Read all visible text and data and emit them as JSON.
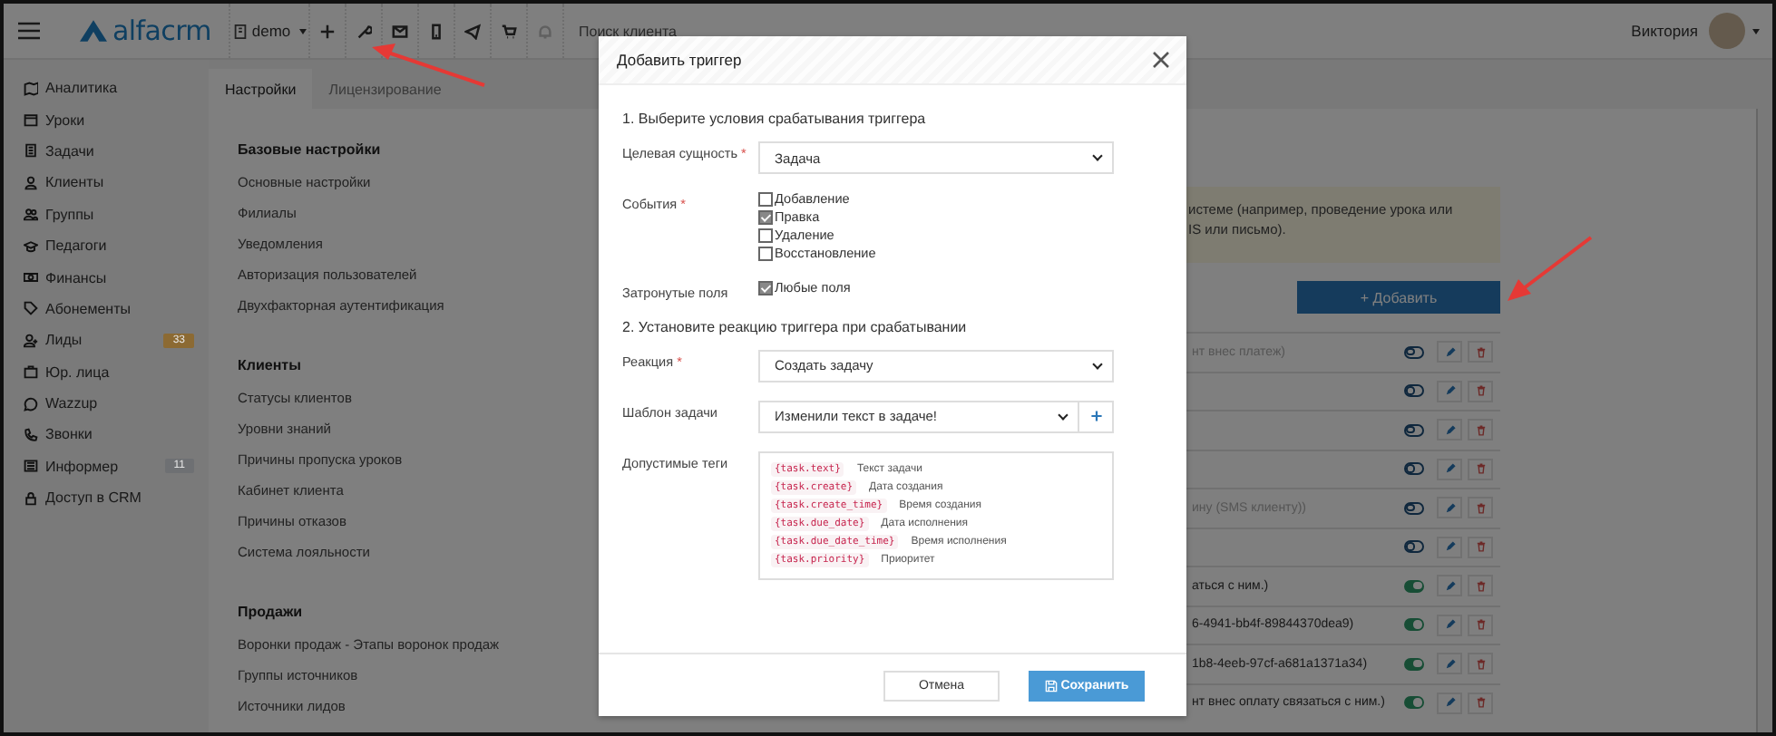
{
  "topbar": {
    "logo": "alfacrm",
    "branch": "demo",
    "search": {
      "placeholder": "Поиск клиента"
    },
    "user": "Виктория"
  },
  "sidebar": {
    "items": [
      {
        "label": "Аналитика"
      },
      {
        "label": "Уроки"
      },
      {
        "label": "Задачи"
      },
      {
        "label": "Клиенты"
      },
      {
        "label": "Группы"
      },
      {
        "label": "Педагоги"
      },
      {
        "label": "Финансы"
      },
      {
        "label": "Абонементы"
      },
      {
        "label": "Лиды",
        "badge": "33",
        "color": "#8c6a33"
      },
      {
        "label": "Юр. лица"
      },
      {
        "label": "Wazzup"
      },
      {
        "label": "Звонки"
      },
      {
        "label": "Информер",
        "badge": "11",
        "color": "#6e7073"
      },
      {
        "label": "Доступ в CRM"
      }
    ]
  },
  "tabs": [
    {
      "label": "Настройки",
      "selected": true
    },
    {
      "label": "Лицензирование",
      "selected": false
    }
  ],
  "settings": [
    {
      "heading": "Базовые настройки",
      "items": [
        "Основные настройки",
        "Филиалы",
        "Уведомления",
        "Авторизация пользователей",
        "Двухфакторная аутентификация"
      ]
    },
    {
      "heading": "Клиенты",
      "items": [
        "Статусы клиентов",
        "Уровни знаний",
        "Причины пропуска уроков",
        "Кабинет клиента",
        "Причины отказов",
        "Система лояльности"
      ]
    },
    {
      "heading": "Продажи",
      "items": [
        "Воронки продаж - Этапы воронок продаж",
        "Группы источников",
        "Источники лидов"
      ]
    }
  ],
  "notice": [
    "истеме (например, проведение урока или",
    "IS или письмо)."
  ],
  "add_button": "+ Добавить",
  "triggers": [
    {
      "text": "нт внес платеж)",
      "on": false
    },
    {
      "on": false
    },
    {
      "on": false
    },
    {
      "on": false
    },
    {
      "text": "ину (SMS клиенту))",
      "on": false
    },
    {
      "on": false
    },
    {
      "text": "аться с ним.)",
      "on": true
    },
    {
      "text": "6-4941-bb4f-89844370dea9)",
      "on": true
    },
    {
      "text": "1b8-4eeb-97cf-a681a1371a34)",
      "on": true
    },
    {
      "text": "нт внес оплату связаться с ним.)",
      "on": true
    }
  ],
  "modal": {
    "title": "Добавить триггер",
    "section_1": "1. Выберите условия срабатывания триггера",
    "target": {
      "label": "Целевая сущность",
      "required": "*",
      "value": "Задача"
    },
    "events": {
      "label": "События",
      "required": "*",
      "options": [
        {
          "label": "Добавление",
          "checked": false
        },
        {
          "label": "Правка",
          "checked": true
        },
        {
          "label": "Удаление",
          "checked": false
        },
        {
          "label": "Восстановление",
          "checked": false
        }
      ]
    },
    "fields": {
      "label": "Затронутые поля",
      "option": {
        "label": "Любые поля",
        "checked": true
      }
    },
    "section_2": "2. Установите реакцию триггера при срабатывании",
    "reaction": {
      "label": "Реакция",
      "required": "*",
      "value": "Создать задачу"
    },
    "template": {
      "label": "Шаблон задачи",
      "value": "Изменили текст в задаче!"
    },
    "tags": {
      "label": "Допустимые теги",
      "items": [
        {
          "code": "{task.text}",
          "description": "Текст задачи"
        },
        {
          "code": "{task.create}",
          "description": "Дата создания"
        },
        {
          "code": "{task.create_time}",
          "description": "Время создания"
        },
        {
          "code": "{task.due_date}",
          "description": "Дата исполнения"
        },
        {
          "code": "{task.due_date_time}",
          "description": "Время исполнения"
        },
        {
          "code": "{task.priority}",
          "description": "Приоритет"
        }
      ]
    },
    "cancel": "Отмена",
    "save": "Сохранить"
  }
}
